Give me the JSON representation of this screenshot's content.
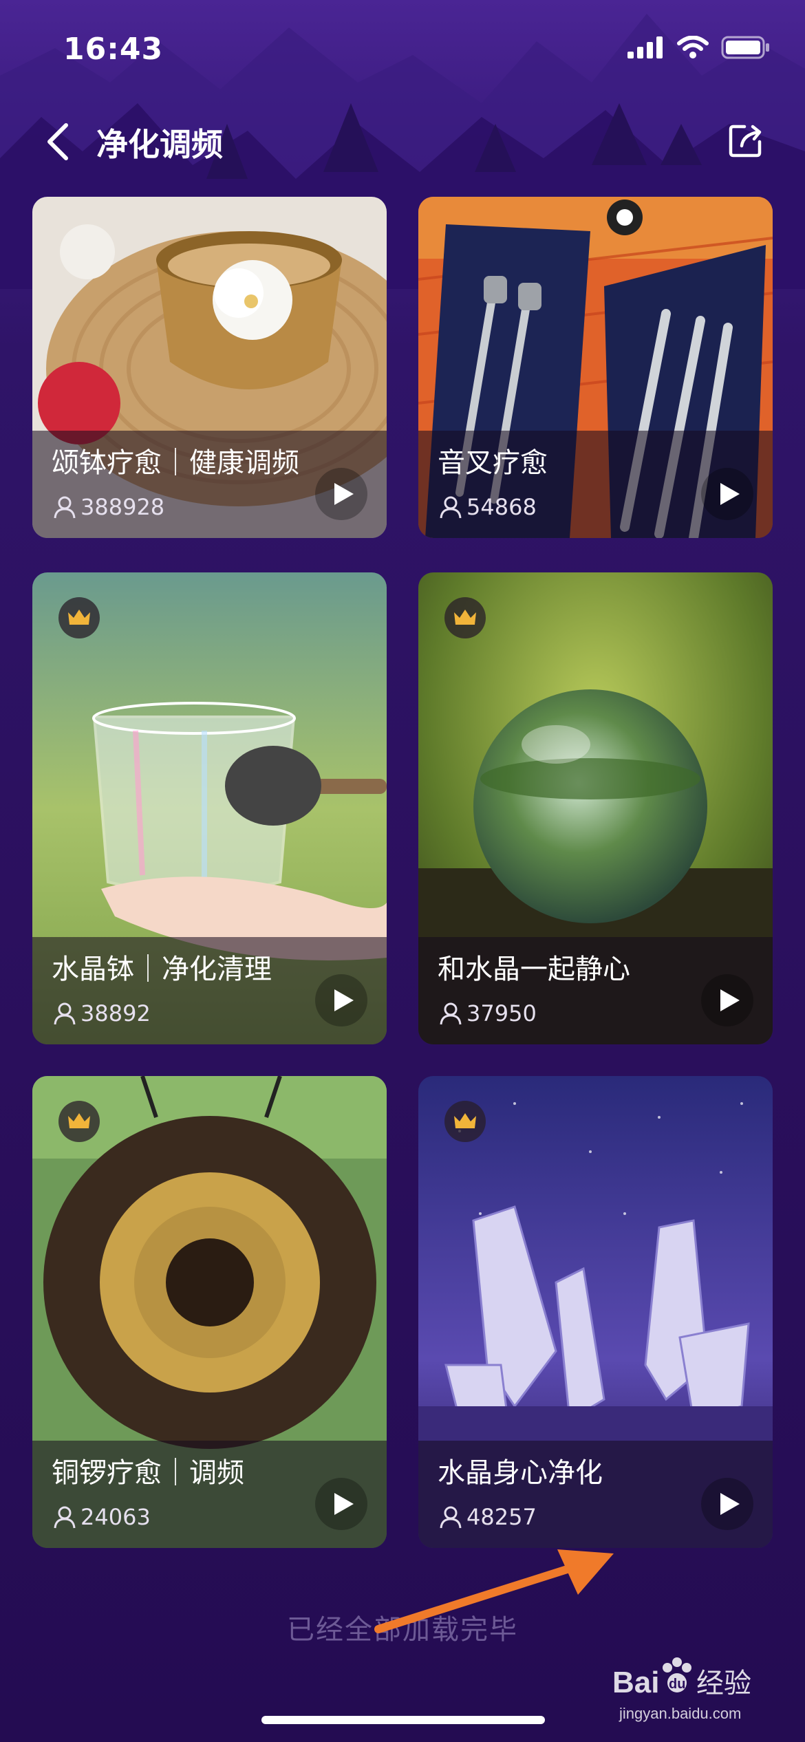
{
  "status_bar": {
    "time": "16:43"
  },
  "nav": {
    "title": "净化调频",
    "back_icon": "chevron-left-icon",
    "share_icon": "share-icon"
  },
  "cards": [
    {
      "title": "颂钵疗愈｜健康调频",
      "listeners": "388928",
      "premium": false
    },
    {
      "title": "音叉疗愈",
      "listeners": "54868",
      "premium": false
    },
    {
      "title": "水晶钵｜净化清理",
      "listeners": "38892",
      "premium": true
    },
    {
      "title": "和水晶一起静心",
      "listeners": "37950",
      "premium": true
    },
    {
      "title": "铜锣疗愈｜调频",
      "listeners": "24063",
      "premium": true
    },
    {
      "title": "水晶身心净化",
      "listeners": "48257",
      "premium": true
    }
  ],
  "footer": {
    "end_text": "已经全部加载完毕"
  },
  "watermark": {
    "text_latin": "Bai",
    "text_du": "du",
    "text_cn": "经验",
    "url": "jingyan.baidu.com"
  },
  "colors": {
    "background": "#2a0f5e",
    "accent_arrow": "#f07a2a",
    "crown": "#f1b43a"
  }
}
